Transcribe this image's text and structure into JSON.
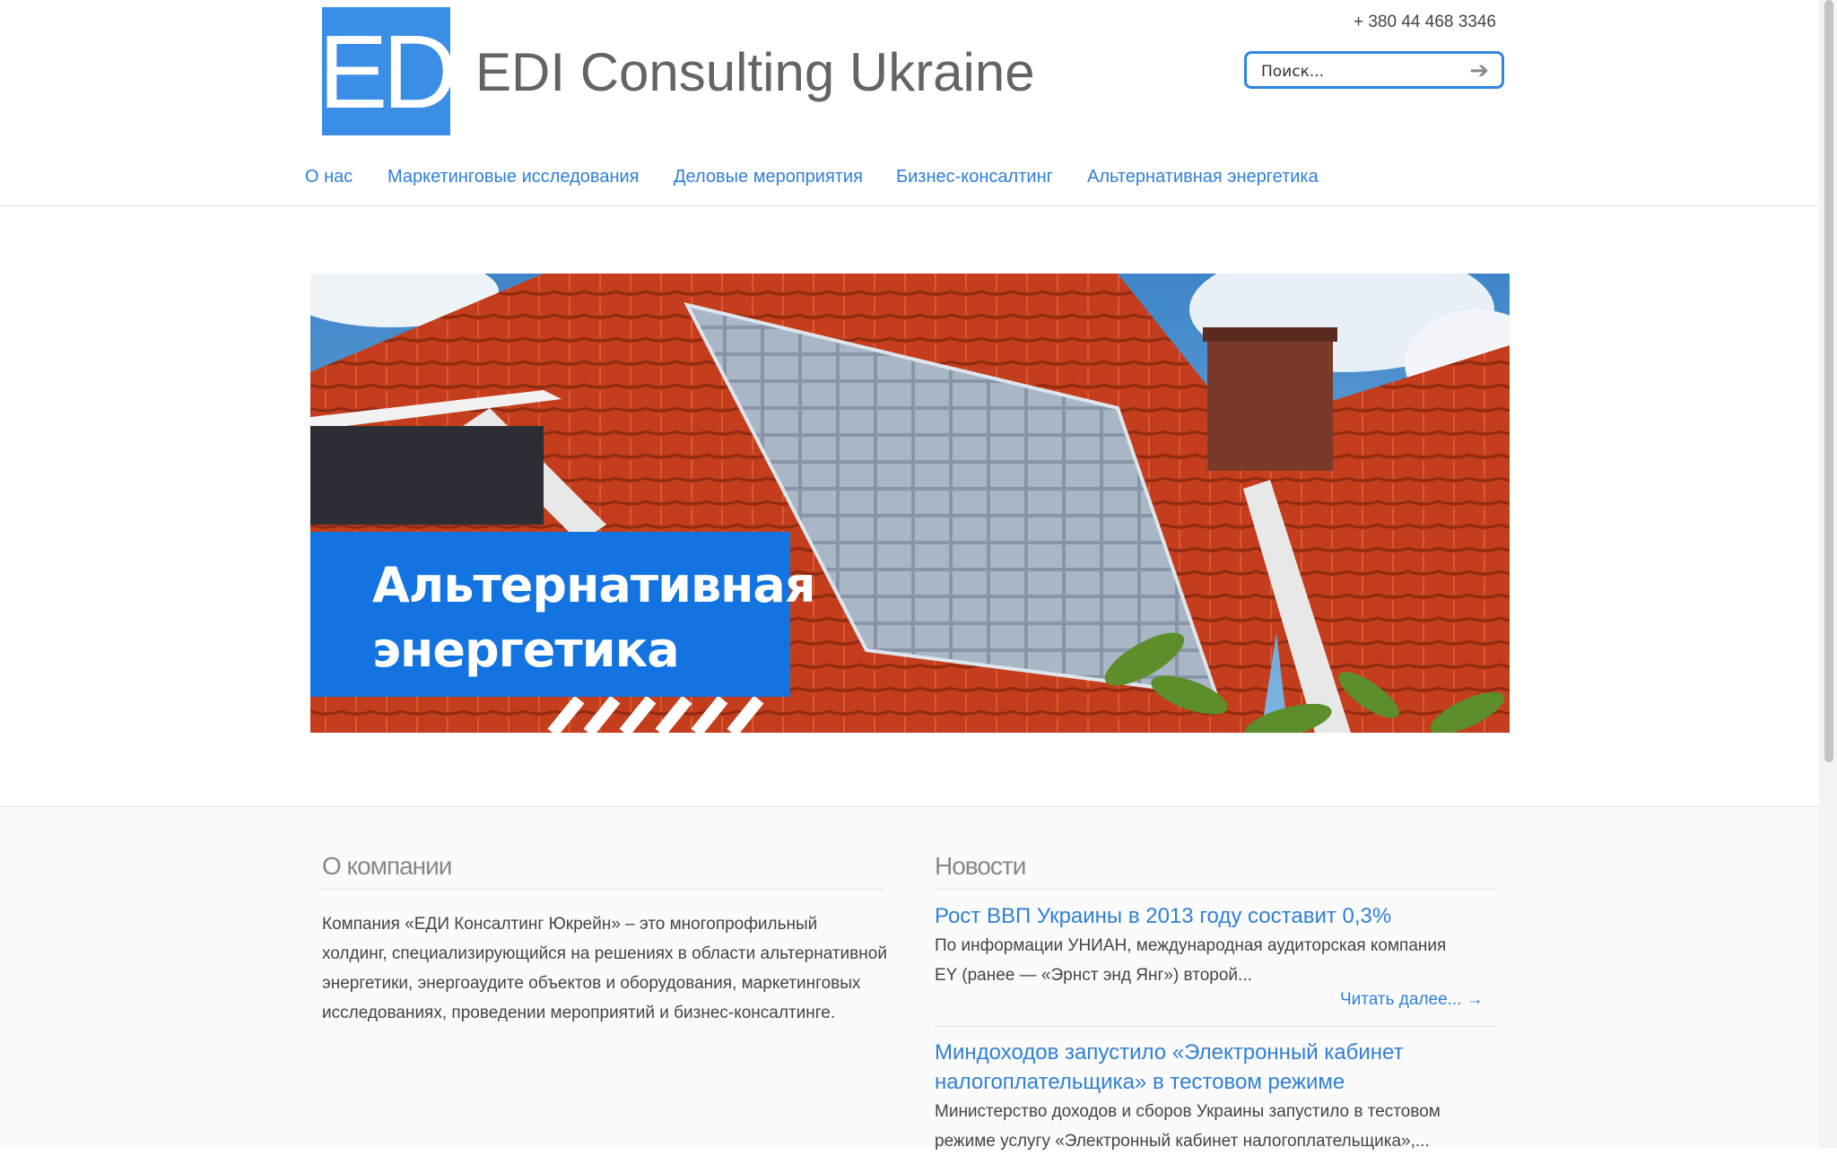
{
  "header": {
    "logo_text": "EDI",
    "site_title": "EDI Consulting Ukraine",
    "phone": "+ 380 44 468 3346",
    "search_placeholder": "Поиск...",
    "search_icon": "arrow-right-icon"
  },
  "nav": {
    "items": [
      {
        "label": "О нас"
      },
      {
        "label": "Маркетинговые исследования"
      },
      {
        "label": "Деловые мероприятия"
      },
      {
        "label": "Бизнес-консалтинг"
      },
      {
        "label": "Альтернативная энергетика"
      }
    ]
  },
  "hero": {
    "caption_line1": "Альтернативная",
    "caption_line2": "энергетика"
  },
  "about": {
    "title": "О компании",
    "text": "Компания «ЕДИ Консалтинг Юкрейн» – это многопрофильный холдинг, специализирующийся на решениях в области альтернативной энергетики, энергоаудите объектов и оборудования, маркетинговых исследованиях, проведении мероприятий и бизнес-консалтинге."
  },
  "news": {
    "title": "Новости",
    "items": [
      {
        "title": "Рост ВВП Украины в 2013 году составит 0,3%",
        "excerpt_line1": "По информации УНИАН, международная аудиторская компания",
        "excerpt_line2": "EY (ранее — «Эрнст энд Янг») второй..."
      },
      {
        "title_line1": "Миндоходов запустило «Электронный кабинет",
        "title_line2": "налогоплательщика» в тестовом режиме",
        "excerpt_line1": "Министерство доходов и сборов Украины запустило в тестовом",
        "excerpt_line2": "режиме услугу «Электронный кабинет налогоплательщика»,..."
      }
    ],
    "read_more": "Читать далее... →"
  },
  "colors": {
    "accent": "#2f80d8",
    "logo_blue": "#3b8ee6",
    "caption_blue": "#1373e0",
    "roof_red": "#c8401f"
  }
}
